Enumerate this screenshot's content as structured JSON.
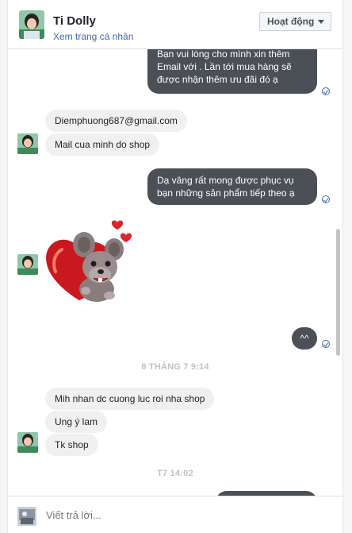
{
  "header": {
    "name": "Ti Dolly",
    "profile_link": "Xem trang cá nhân",
    "status_label": "Hoạt động"
  },
  "messages": {
    "me_1": [
      "Bạn vui lòng cho mình xin thêm",
      "Email với . Lần tới mua hàng sẽ",
      "được nhận thêm ưu đãi đó ạ"
    ],
    "them_email": "Diemphuong687@gmail.com",
    "them_mail": "Mail cua minh do shop",
    "me_2": [
      "Dạ vâng rất mong được phục vụ",
      "bạn những sản phẩm tiếp theo ạ"
    ],
    "sticker": "mouse-heart-sticker",
    "me_3": "^^",
    "timestamp_1": "8 THÁNG 7 9:14",
    "them_received": "Mih nhan dc cuong luc roi nha shop",
    "them_ung": "Ung ý lam",
    "them_tk": "Tk shop",
    "timestamp_2": "T7 14:02"
  },
  "composer": {
    "placeholder": "Viết trả lời..."
  },
  "colors": {
    "outgoing_bubble": "#4b4f56",
    "incoming_bubble": "#f1f0f0",
    "link": "#4267b2"
  }
}
